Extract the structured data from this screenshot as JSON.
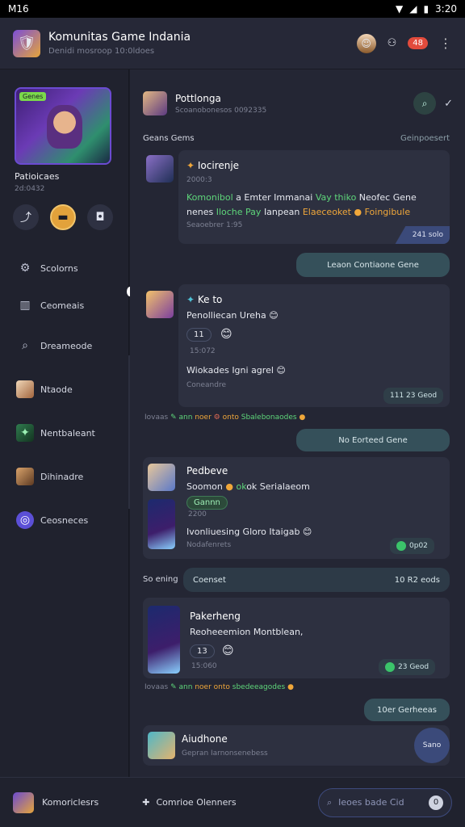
{
  "status": {
    "left": "M16",
    "right": "3:20"
  },
  "app": {
    "title": "Komunitas Game Indania",
    "subtitle": "Denidi mosroop 10:0ldoes",
    "notif_count": "48"
  },
  "sidebar": {
    "hero_tag": "Genes",
    "name": "Patioicaes",
    "sub": "2d:0432",
    "nav": [
      {
        "label": "Scolorns",
        "icon": "settings-icon"
      },
      {
        "label": "Ceomeais",
        "icon": "chart-icon"
      },
      {
        "label": "Dreameode",
        "icon": "search-icon"
      },
      {
        "label": "Ntaode",
        "icon": "avatar-image"
      },
      {
        "label": "Nentbaleant",
        "icon": "game-image"
      },
      {
        "label": "Dihinadre",
        "icon": "avatar-image"
      },
      {
        "label": "Ceosneces",
        "icon": "circle-icon"
      }
    ]
  },
  "chat": {
    "title": "Pottlonga",
    "subtitle": "Scoanobonesos 0092335",
    "section_left": "Geans Gems",
    "section_right": "Geinpoesert",
    "m1": {
      "name": "Iocirenje",
      "sub": "2000:3",
      "line1a": "Komonibol",
      "line1b": "a Emter Immanai",
      "line1c": "Vay thiko",
      "line1d": "Neofec Gene",
      "line2a": "nenes",
      "line2b": "Iloche Pay",
      "line2c": "Ianpean",
      "line2d": "Elaeceoket",
      "line2e": "Foingibule",
      "footer": "Seaoebrer 1:95",
      "corner": "241 solo"
    },
    "join1": "Leaon Contiaone Gene",
    "m2": {
      "name": "Ke to",
      "line1": "Penolliecan Ureha",
      "reaction": "11",
      "time": "15:072",
      "line2": "Wiokades Igni agrel",
      "footer": "Coneandre",
      "meta": "111 23 Geod"
    },
    "sys1": {
      "a": "Iovaas",
      "b": "ann",
      "c": "noer",
      "d": "onto",
      "e": "Sbalebonaodes"
    },
    "join2": "No Eorteed Gene",
    "m3": {
      "name": "Pedbeve",
      "line1": "Soomon",
      "line1b": "ok Serialaeom",
      "tag": "Gannn",
      "sub": "2200",
      "line2": "Ivonliuesing Gloro Itaigab",
      "footer": "Nodafenrets",
      "meta": "0p02"
    },
    "channel": {
      "left": "So ening",
      "pill": "Coenset",
      "right": "10 R2 eods"
    },
    "m4": {
      "name": "Pakerheng",
      "line1": "Reoheeemion Montblean,",
      "reaction": "13",
      "time": "15:060",
      "meta": "23 Geod"
    },
    "sys2": {
      "a": "Iovaas",
      "b": "ann",
      "c": "noer",
      "d": "onto",
      "e": "sbedeeagodes"
    },
    "join3": "10er Gerheeas",
    "m5": {
      "name": "Aiudhone",
      "sub": "Gepran Iarnonsenebess"
    },
    "fab": "Sano"
  },
  "bottom": {
    "left": "Komoriclesrs",
    "mid": "Comrioe Olenners",
    "search": "Ieoes bade Cid",
    "count": "0"
  }
}
